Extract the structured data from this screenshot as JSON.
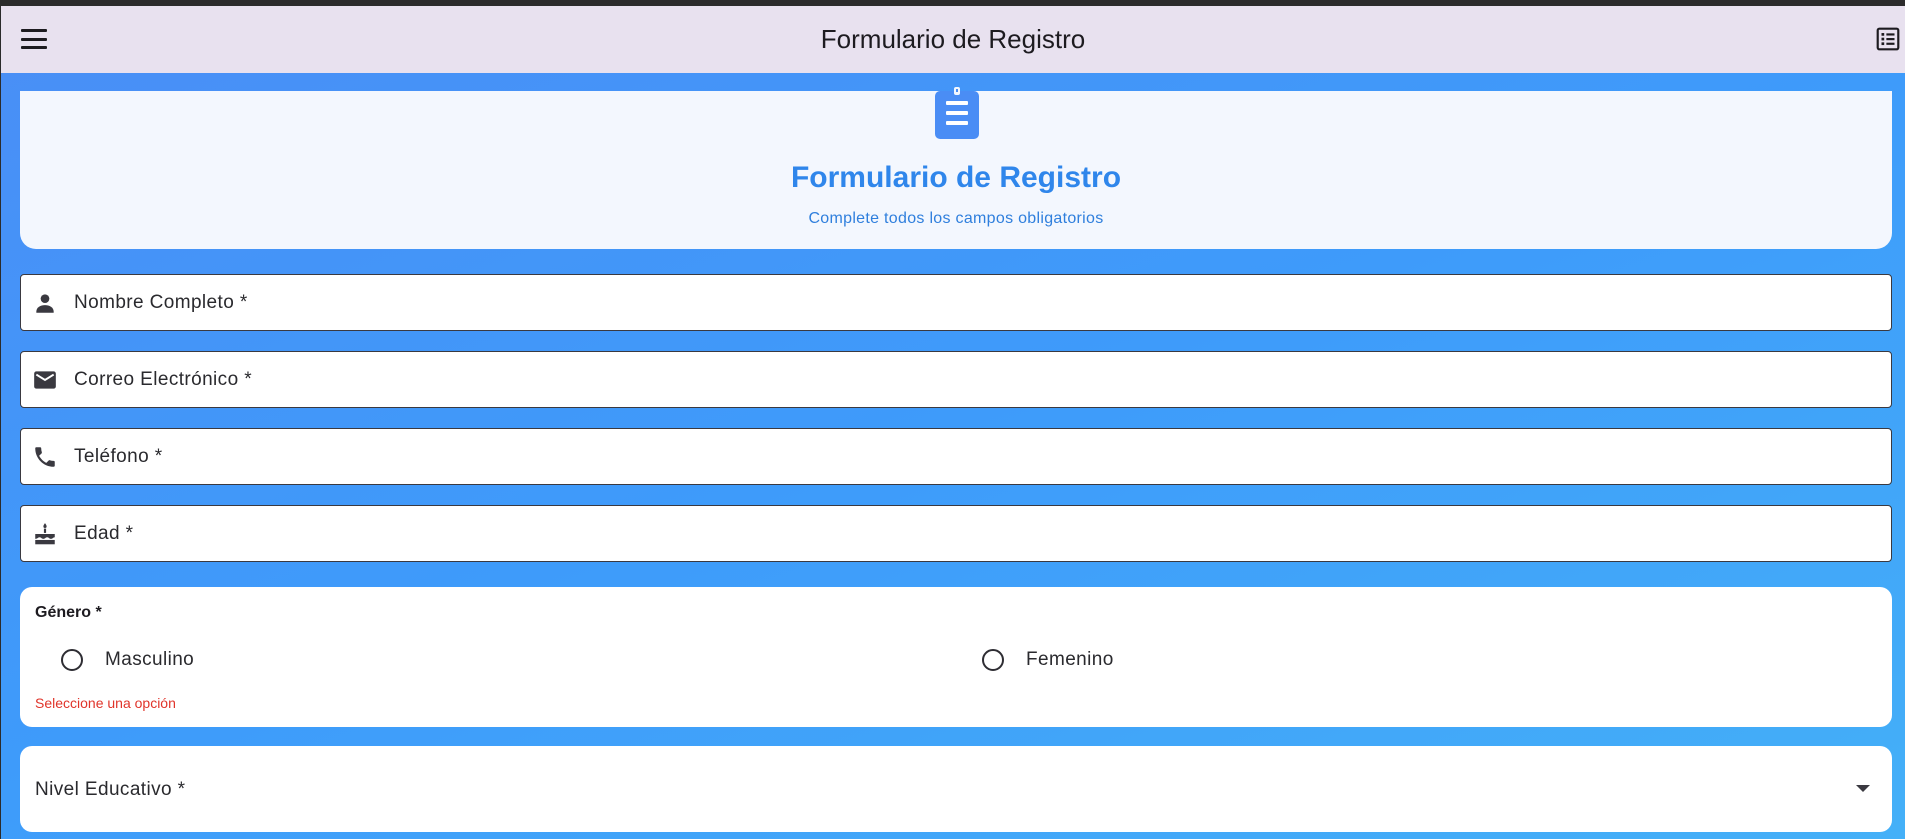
{
  "appbar": {
    "title": "Formulario de Registro",
    "menu_icon": "menu-icon",
    "list_icon": "list-alt-icon"
  },
  "header": {
    "icon": "clipboard-list-icon",
    "title": "Formulario de Registro",
    "subtitle": "Complete todos los campos obligatorios"
  },
  "fields": [
    {
      "label": "Nombre Completo *",
      "icon": "person-icon",
      "value": ""
    },
    {
      "label": "Correo Electrónico *",
      "icon": "email-icon",
      "value": ""
    },
    {
      "label": "Teléfono *",
      "icon": "phone-icon",
      "value": ""
    },
    {
      "label": "Edad *",
      "icon": "cake-icon",
      "value": ""
    }
  ],
  "gender": {
    "title": "Género *",
    "options": [
      "Masculino",
      "Femenino"
    ],
    "selected": null,
    "error": "Seleccione una opción"
  },
  "education": {
    "label": "Nivel Educativo *",
    "value": ""
  },
  "colors": {
    "accent": "#2f86eb",
    "appbar_bg": "#e8e1ef",
    "error": "#e0342a",
    "background_gradient_start": "#4a8ef6",
    "background_gradient_end": "#44b0f8"
  }
}
